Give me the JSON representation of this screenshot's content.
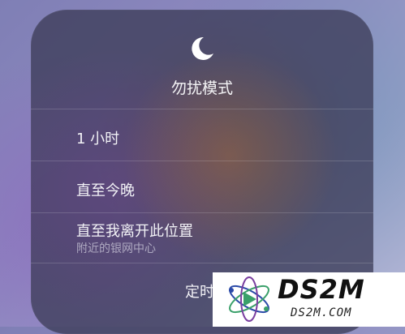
{
  "panel": {
    "icon": "moon-icon",
    "title": "勿扰模式",
    "options": [
      {
        "label": "1 小时"
      },
      {
        "label": "直至今晚"
      },
      {
        "label": "直至我离开此位置",
        "sublabel": "附近的银网中心"
      }
    ],
    "schedule_label": "定时"
  },
  "watermark": {
    "title": "DS2M",
    "subtitle": "DS2M.COM"
  },
  "colors": {
    "panel_bg": "#3c3c58",
    "text": "#f2f2f6",
    "secondary_text": "#b9b9c8"
  }
}
